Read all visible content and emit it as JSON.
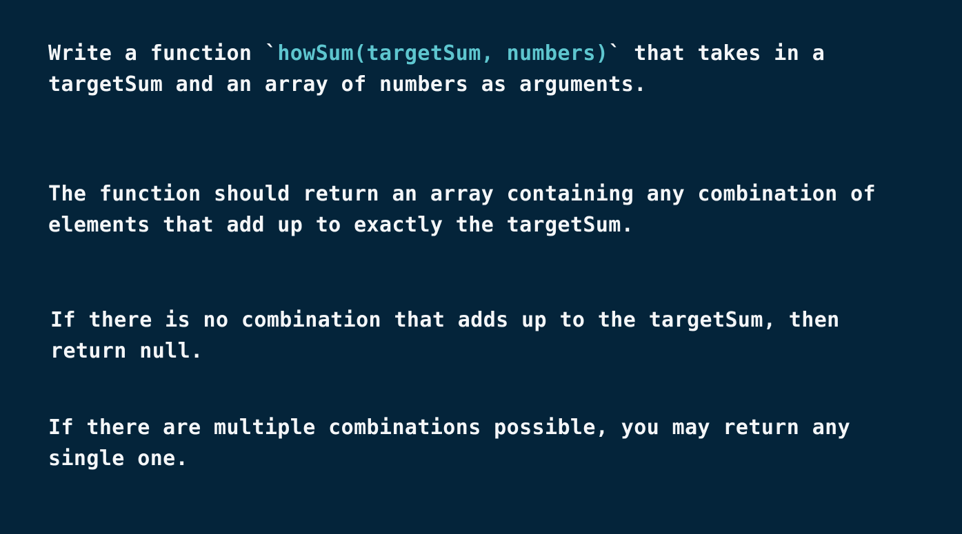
{
  "colors": {
    "background": "#04243a",
    "text": "#f4f6f8",
    "code_accent": "#5ec6cf"
  },
  "paragraphs": {
    "p1": {
      "line1_prefix": "Write a function `",
      "line1_code": "howSum(targetSum, numbers)",
      "line1_suffix": "` that takes in a",
      "line2": "targetSum and an array of numbers as arguments."
    },
    "p2": {
      "line1": "The function should return an array containing any combination of",
      "line2": "elements that add up to exactly the targetSum."
    },
    "p3": {
      "line1": "If there is no combination that adds up to the targetSum, then",
      "line2": "return null."
    },
    "p4": {
      "line1": "If there are multiple combinations possible, you may return any",
      "line2": "single one."
    }
  }
}
